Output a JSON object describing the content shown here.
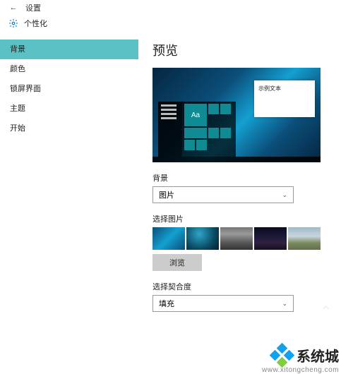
{
  "titlebar": {
    "back_glyph": "←",
    "title": "设置"
  },
  "header": {
    "section": "个性化"
  },
  "sidebar": {
    "items": [
      {
        "label": "背景",
        "active": true
      },
      {
        "label": "颜色"
      },
      {
        "label": "锁屏界面"
      },
      {
        "label": "主题"
      },
      {
        "label": "开始"
      }
    ]
  },
  "content": {
    "preview_heading": "预览",
    "sample_text": "示例文本",
    "tile_glyph": "Aa",
    "background_label": "背景",
    "background_value": "图片",
    "choose_image_label": "选择图片",
    "browse_label": "浏览",
    "fit_label": "选择契合度",
    "fit_value": "填充"
  },
  "watermark": {
    "brand": "系统城",
    "url": "www.xitongcheng.com"
  }
}
